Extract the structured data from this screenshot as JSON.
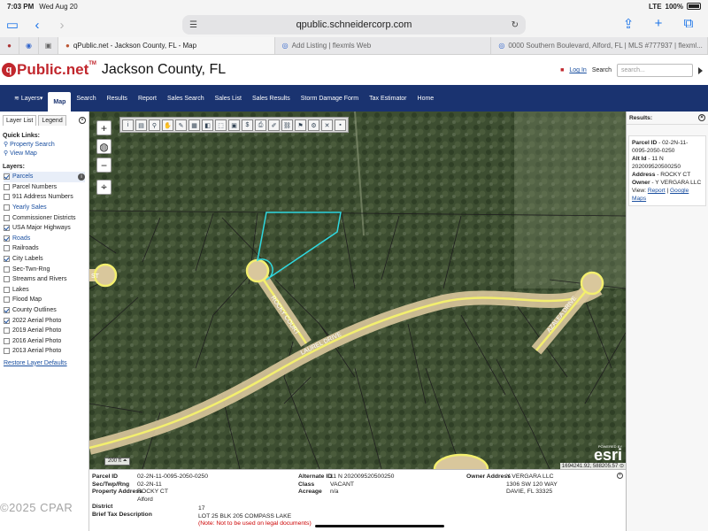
{
  "status_bar": {
    "time": "7:03 PM",
    "date": "Wed Aug 20",
    "signal": "LTE",
    "battery": "100%"
  },
  "safari": {
    "url": "qpublic.schneidercorp.com"
  },
  "tabs": [
    {
      "label": "qPublic.net - Jackson County, FL - Map",
      "active": true
    },
    {
      "label": "Add Listing | flexmls Web",
      "active": false
    },
    {
      "label": "0000 Southern Boulevard, Alford, FL | MLS #777937 | flexml...",
      "active": false
    }
  ],
  "header": {
    "logo_mark": "q",
    "logo_text": "Public.net",
    "logo_tm": "TM",
    "county": "Jackson County, FL",
    "login": "Log In",
    "search_label": "Search",
    "search_placeholder": "search..."
  },
  "nav": {
    "items": [
      "Layers",
      "Map",
      "Search",
      "Results",
      "Report",
      "Sales Search",
      "Sales List",
      "Sales Results",
      "Storm Damage Form",
      "Tax Estimator",
      "Home"
    ],
    "active": "Map"
  },
  "left_panel": {
    "tabs": [
      "Layer List",
      "Legend"
    ],
    "quick_links_title": "Quick Links:",
    "quick_links": [
      "Property Search",
      "View Map"
    ],
    "layers_title": "Layers:",
    "layers": [
      {
        "label": "Parcels",
        "checked": true,
        "link": true,
        "info": true
      },
      {
        "label": "Parcel Numbers",
        "checked": false,
        "link": false
      },
      {
        "label": "911 Address Numbers",
        "checked": false,
        "link": false
      },
      {
        "label": "Yearly Sales",
        "checked": false,
        "link": true
      },
      {
        "label": "Commissioner Districts",
        "checked": false,
        "link": false
      },
      {
        "label": "USA Major Highways",
        "checked": true,
        "link": false
      },
      {
        "label": "Roads",
        "checked": true,
        "link": true
      },
      {
        "label": "Railroads",
        "checked": false,
        "link": false
      },
      {
        "label": "City Labels",
        "checked": true,
        "link": false
      },
      {
        "label": "Sec-Twn-Rng",
        "checked": false,
        "link": false
      },
      {
        "label": "Streams and Rivers",
        "checked": false,
        "link": false
      },
      {
        "label": "Lakes",
        "checked": false,
        "link": false
      },
      {
        "label": "Flood Map",
        "checked": false,
        "link": false
      },
      {
        "label": "County Outlines",
        "checked": true,
        "link": false
      },
      {
        "label": "2022 Aerial Photo",
        "checked": true,
        "link": false
      },
      {
        "label": "2019 Aerial Photo",
        "checked": false,
        "link": false
      },
      {
        "label": "2016 Aerial Photo",
        "checked": false,
        "link": false
      },
      {
        "label": "2013 Aerial Photo",
        "checked": false,
        "link": false
      }
    ],
    "restore": "Restore Layer Defaults"
  },
  "map": {
    "road_labels": [
      "ROCKY COURT",
      "LAUREL DRIVE",
      "AZALEA DRIVE",
      "ST"
    ],
    "scale": "200 ft",
    "esri_powered": "POWERED BY",
    "esri": "esri",
    "coords": "1694241.92, 588205.57"
  },
  "results": {
    "title": "Results:",
    "parcel_id_label": "Parcel ID",
    "parcel_id": "02-2N-11-0095-2050-0250",
    "alt_id_label": "Alt Id",
    "alt_id": "11 N 202009520500250",
    "address_label": "Address",
    "address": "ROCKY CT",
    "owner_label": "Owner",
    "owner": "Y VERGARA LLC",
    "view_label": "View:",
    "report": "Report",
    "google_maps": "Google Maps"
  },
  "detail": {
    "parcel_id_label": "Parcel ID",
    "parcel_id": "02-2N-11-0095-2050-0250",
    "str_label": "Sec/Twp/Rng",
    "str": "02-2N-11",
    "address_label": "Property Address",
    "address_line1": "ROCKY CT",
    "address_line2": "Alford",
    "district_label": "District",
    "district": "17",
    "brief_label": "Brief Tax Description",
    "brief": "LOT 25 BLK 205 COMPASS LAKE",
    "note": "(Note: Not to be used on legal documents)",
    "alt_id_label": "Alternate ID",
    "alt_id": "11 N 202009520500250",
    "class_label": "Class",
    "class": "VACANT",
    "acreage_label": "Acreage",
    "acreage": "n/a",
    "owner_label": "Owner Address",
    "owner1": "Y VERGARA LLC",
    "owner2": "1306 SW 120 WAY",
    "owner3": "DAVIE, FL 33325"
  },
  "watermark": "©2025 CPAR"
}
